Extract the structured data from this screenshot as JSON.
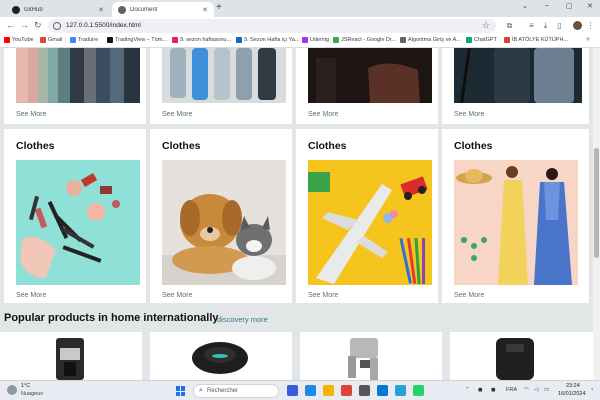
{
  "browser": {
    "tabs": [
      {
        "title": "GitHub",
        "icon": "github-icon"
      },
      {
        "title": "Document",
        "icon": "document-icon"
      }
    ],
    "new_tab": "+",
    "window_controls": [
      "⌄",
      "–",
      "▢",
      "✕"
    ],
    "url": "127.0.0.1:5500/index.html",
    "bookmarks": [
      {
        "label": "YouTube",
        "color": "#ff0000"
      },
      {
        "label": "Gmail",
        "color": "#ea4335"
      },
      {
        "label": "Traduire",
        "color": "#4285f4"
      },
      {
        "label": "TradingView – Tüm...",
        "color": "#131722"
      },
      {
        "label": "9. sezon haftasonu...",
        "color": "#e91e63"
      },
      {
        "label": "9. Sezon Hafta içi Ya...",
        "color": "#1565c0"
      },
      {
        "label": "Udemig",
        "color": "#a435f0"
      },
      {
        "label": "JSReact - Google Dr...",
        "color": "#34a853"
      },
      {
        "label": "Algoritma Giriş ve A...",
        "color": "#5f6368"
      },
      {
        "label": "ChatGPT",
        "color": "#10a37f"
      },
      {
        "label": "İB ATÖLYE KÜTÜPH...",
        "color": "#e53935"
      }
    ]
  },
  "page": {
    "top_cards": [
      {
        "see_more": "See More"
      },
      {
        "see_more": "See More"
      },
      {
        "see_more": "See More"
      },
      {
        "see_more": "See More"
      }
    ],
    "cards": [
      {
        "title": "Clothes",
        "see_more": "See More",
        "image": "cosmetics-image"
      },
      {
        "title": "Clothes",
        "see_more": "See More",
        "image": "dog-and-cat-image"
      },
      {
        "title": "Clothes",
        "see_more": "See More",
        "image": "toy-airplane-image"
      },
      {
        "title": "Clothes",
        "see_more": "See More",
        "image": "fashion-models-image"
      }
    ],
    "section": {
      "title": "Popular products in home internationally",
      "link": "discovery more"
    },
    "products": [
      {
        "image": "coffee-machine-image"
      },
      {
        "image": "robot-vacuum-image"
      },
      {
        "image": "espresso-machine-image"
      },
      {
        "image": "air-fryer-image"
      }
    ]
  },
  "taskbar": {
    "weather_temp": "1°C",
    "weather_desc": "Nuageux",
    "search_placeholder": "Rechercher",
    "language": "FRA",
    "time": "23:24",
    "date": "16/01/2024"
  }
}
